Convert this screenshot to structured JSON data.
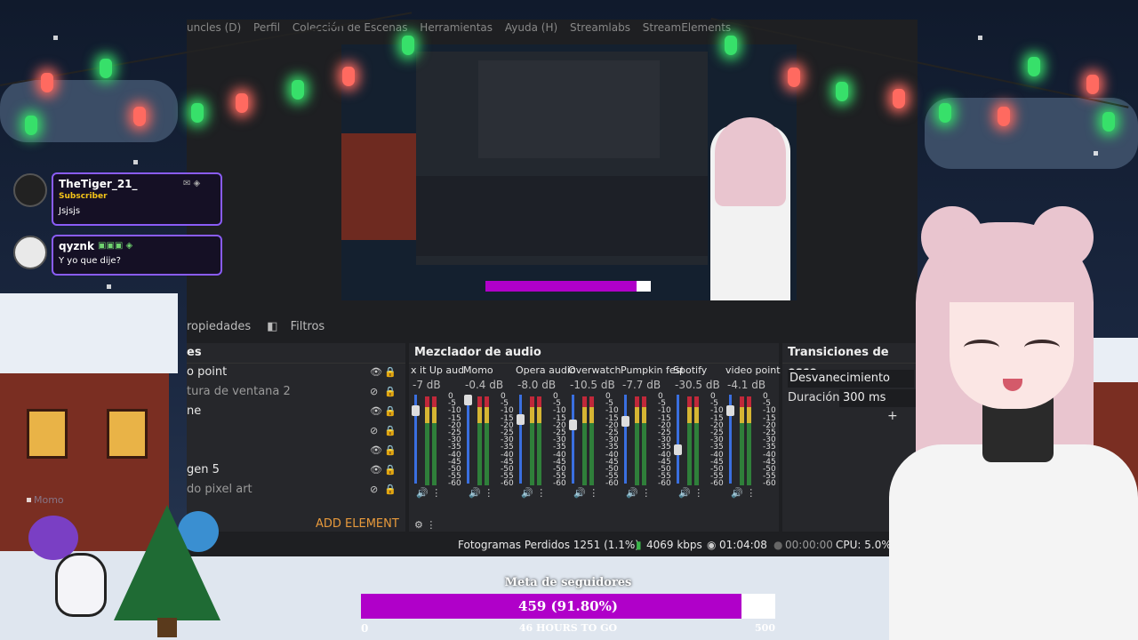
{
  "obs": {
    "menubar": [
      "uncles (D)",
      "Perfil",
      "Colección de Escenas",
      "Herramientas",
      "Ayuda (H)",
      "Streamlabs",
      "StreamElements"
    ],
    "tabs": {
      "properties": "ropiedades",
      "filters": "Filtros"
    },
    "sources": {
      "header": "es",
      "items": [
        {
          "label": "o point",
          "visible": true
        },
        {
          "label": "tura de ventana 2",
          "visible": false
        },
        {
          "label": "ne",
          "visible": true
        },
        {
          "label": "",
          "visible": false
        },
        {
          "label": "",
          "visible": true
        },
        {
          "label": "gen 5",
          "visible": true
        },
        {
          "label": "do pixel art",
          "visible": false
        }
      ],
      "add_element": "ADD ELEMENT"
    },
    "mixer": {
      "title": "Mezclador de audio",
      "scale": [
        "0",
        "-5",
        "-10",
        "-15",
        "-20",
        "-25",
        "-30",
        "-35",
        "-40",
        "-45",
        "-50",
        "-55",
        "-60"
      ],
      "channels": [
        {
          "name": "x it Up aud",
          "db": "-7 dB"
        },
        {
          "name": "Momo",
          "db": "-0.4 dB"
        },
        {
          "name": "Opera audio",
          "db": "-8.0 dB"
        },
        {
          "name": "Overwatch",
          "db": "-10.5 dB"
        },
        {
          "name": "Pumpkin fest",
          "db": "-7.7 dB"
        },
        {
          "name": "Spotify",
          "db": "-30.5 dB"
        },
        {
          "name": "video point",
          "db": "-4.1 dB"
        }
      ]
    },
    "transitions": {
      "title": "Transiciones de esce",
      "selected": "Desvanecimiento",
      "duration_label": "Duración",
      "duration_value": "300 ms"
    },
    "status": {
      "dropped": "Fotogramas Perdidos 1251 (1.1%)",
      "bitrate": "4069 kbps",
      "live_time": "01:04:08",
      "rec_time": "00:00:00",
      "cpu": "CPU: 5.0%"
    }
  },
  "chat": [
    {
      "user": "TheTiger_21_",
      "badge": "Subscriber",
      "message": "Jsjsjs"
    },
    {
      "user": "qyznk",
      "badge": "",
      "message": "Y yo que dije?"
    }
  ],
  "goal": {
    "title": "Meta de seguidores",
    "text": "459 (91.80%)",
    "progress": 0.918,
    "min": "0",
    "max": "500",
    "subtitle": "46 HOURS TO GO"
  },
  "overlay_label": "Momo"
}
